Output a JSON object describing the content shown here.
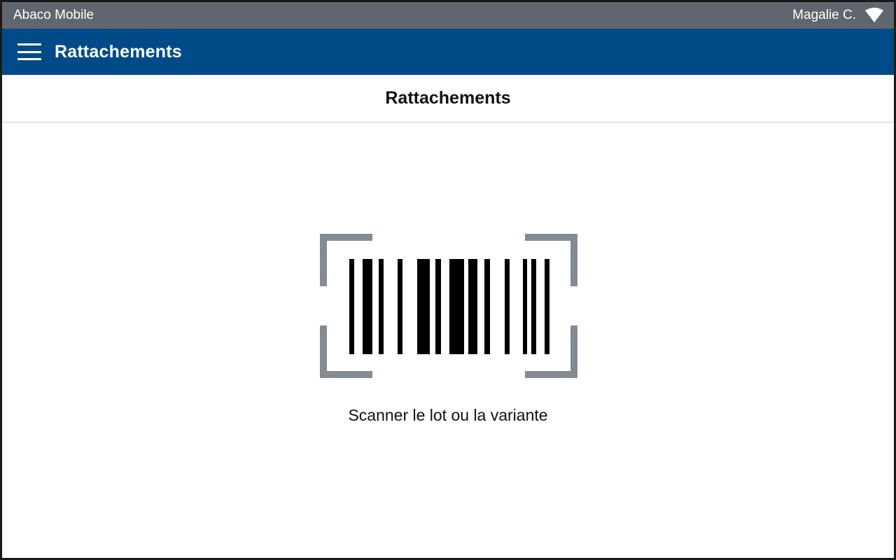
{
  "status_bar": {
    "app_name": "Abaco Mobile",
    "user_name": "Magalie C.",
    "signal_icon": "wifi-icon"
  },
  "app_bar": {
    "menu_icon": "hamburger-menu-icon",
    "title": "Rattachements",
    "color": "#004b87"
  },
  "page": {
    "header_title": "Rattachements"
  },
  "scanner": {
    "icon": "barcode-scan-icon",
    "prompt": "Scanner le lot ou la variante",
    "frame_color": "#858b92"
  }
}
